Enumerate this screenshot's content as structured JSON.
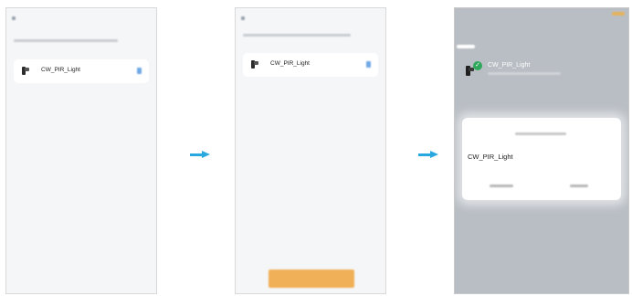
{
  "steps": [
    {
      "device": {
        "name": "CW_PIR_Light"
      }
    },
    {
      "device": {
        "name": "CW_PIR_Light"
      }
    },
    {
      "device": {
        "name": "CW_PIR_Light"
      },
      "rename_dialog": {
        "input_value": "CW_PIR_Light"
      }
    }
  ],
  "colors": {
    "arrow": "#29a8e0",
    "next_button": "#f0a43c",
    "success_check": "#2ea85a",
    "overlay": "#b9bec4"
  },
  "icons": [
    "back-icon",
    "device-icon",
    "edit-icon",
    "arrow-right-icon",
    "check-icon"
  ]
}
